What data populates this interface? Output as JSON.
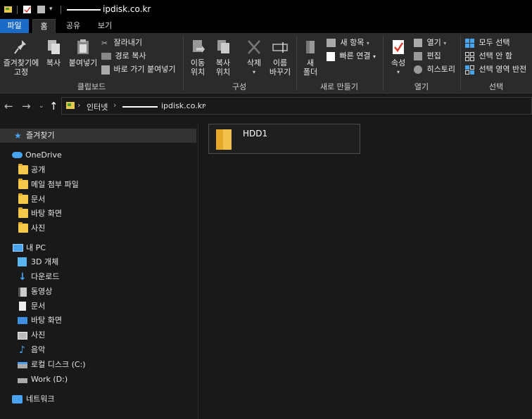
{
  "window": {
    "title": "ipdisk.co.kr"
  },
  "tabs": {
    "file": "파일",
    "home": "홈",
    "share": "공유",
    "view": "보기"
  },
  "ribbon": {
    "clipboard": {
      "pin_quick_access": "즐겨찾기에 고정",
      "copy": "복사",
      "paste": "붙여넣기",
      "cut": "잘라내기",
      "copy_path": "경로 복사",
      "paste_shortcut": "바로 가기 붙여넣기",
      "group_label": "클립보드"
    },
    "organize": {
      "move_to_line1": "이동",
      "move_to_line2": "위치",
      "copy_to_line1": "복사",
      "copy_to_line2": "위치",
      "delete": "삭제",
      "rename_line1": "이름",
      "rename_line2": "바꾸기",
      "group_label": "구성"
    },
    "new": {
      "new_folder_line1": "새",
      "new_folder_line2": "폴더",
      "new_item": "새 항목",
      "easy_access": "빠른 연결",
      "group_label": "새로 만들기"
    },
    "open": {
      "properties": "속성",
      "open": "열기",
      "edit": "편집",
      "history": "히스토리",
      "group_label": "열기"
    },
    "select": {
      "select_all": "모두 선택",
      "select_none": "선택 안 함",
      "invert_selection": "선택 영역 반전",
      "group_label": "선택"
    }
  },
  "address": {
    "crumbs": [
      "인터넷",
      "ipdisk.co.kr"
    ]
  },
  "navpane": {
    "favorites": "즐겨찾기",
    "onedrive": "OneDrive",
    "onedrive_items": [
      "공개",
      "메일 첨부 파일",
      "문서",
      "바탕 화면",
      "사진"
    ],
    "this_pc": "내 PC",
    "pc_items": [
      "3D 개체",
      "다운로드",
      "동영상",
      "문서",
      "바탕 화면",
      "사진",
      "음악",
      "로컬 디스크 (C:)",
      "Work (D:)"
    ],
    "network": "네트워크"
  },
  "content": {
    "items": [
      "HDD1"
    ]
  },
  "colors": {
    "accent": "#1a6bc5",
    "folder": "#f7c94a",
    "background": "#191919",
    "ribbon": "#2b2b2b"
  }
}
